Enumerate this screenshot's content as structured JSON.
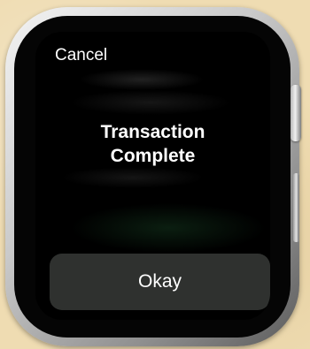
{
  "header": {
    "cancel_label": "Cancel"
  },
  "message": {
    "line1": "Transaction",
    "line2": "Complete"
  },
  "actions": {
    "okay_label": "Okay"
  }
}
